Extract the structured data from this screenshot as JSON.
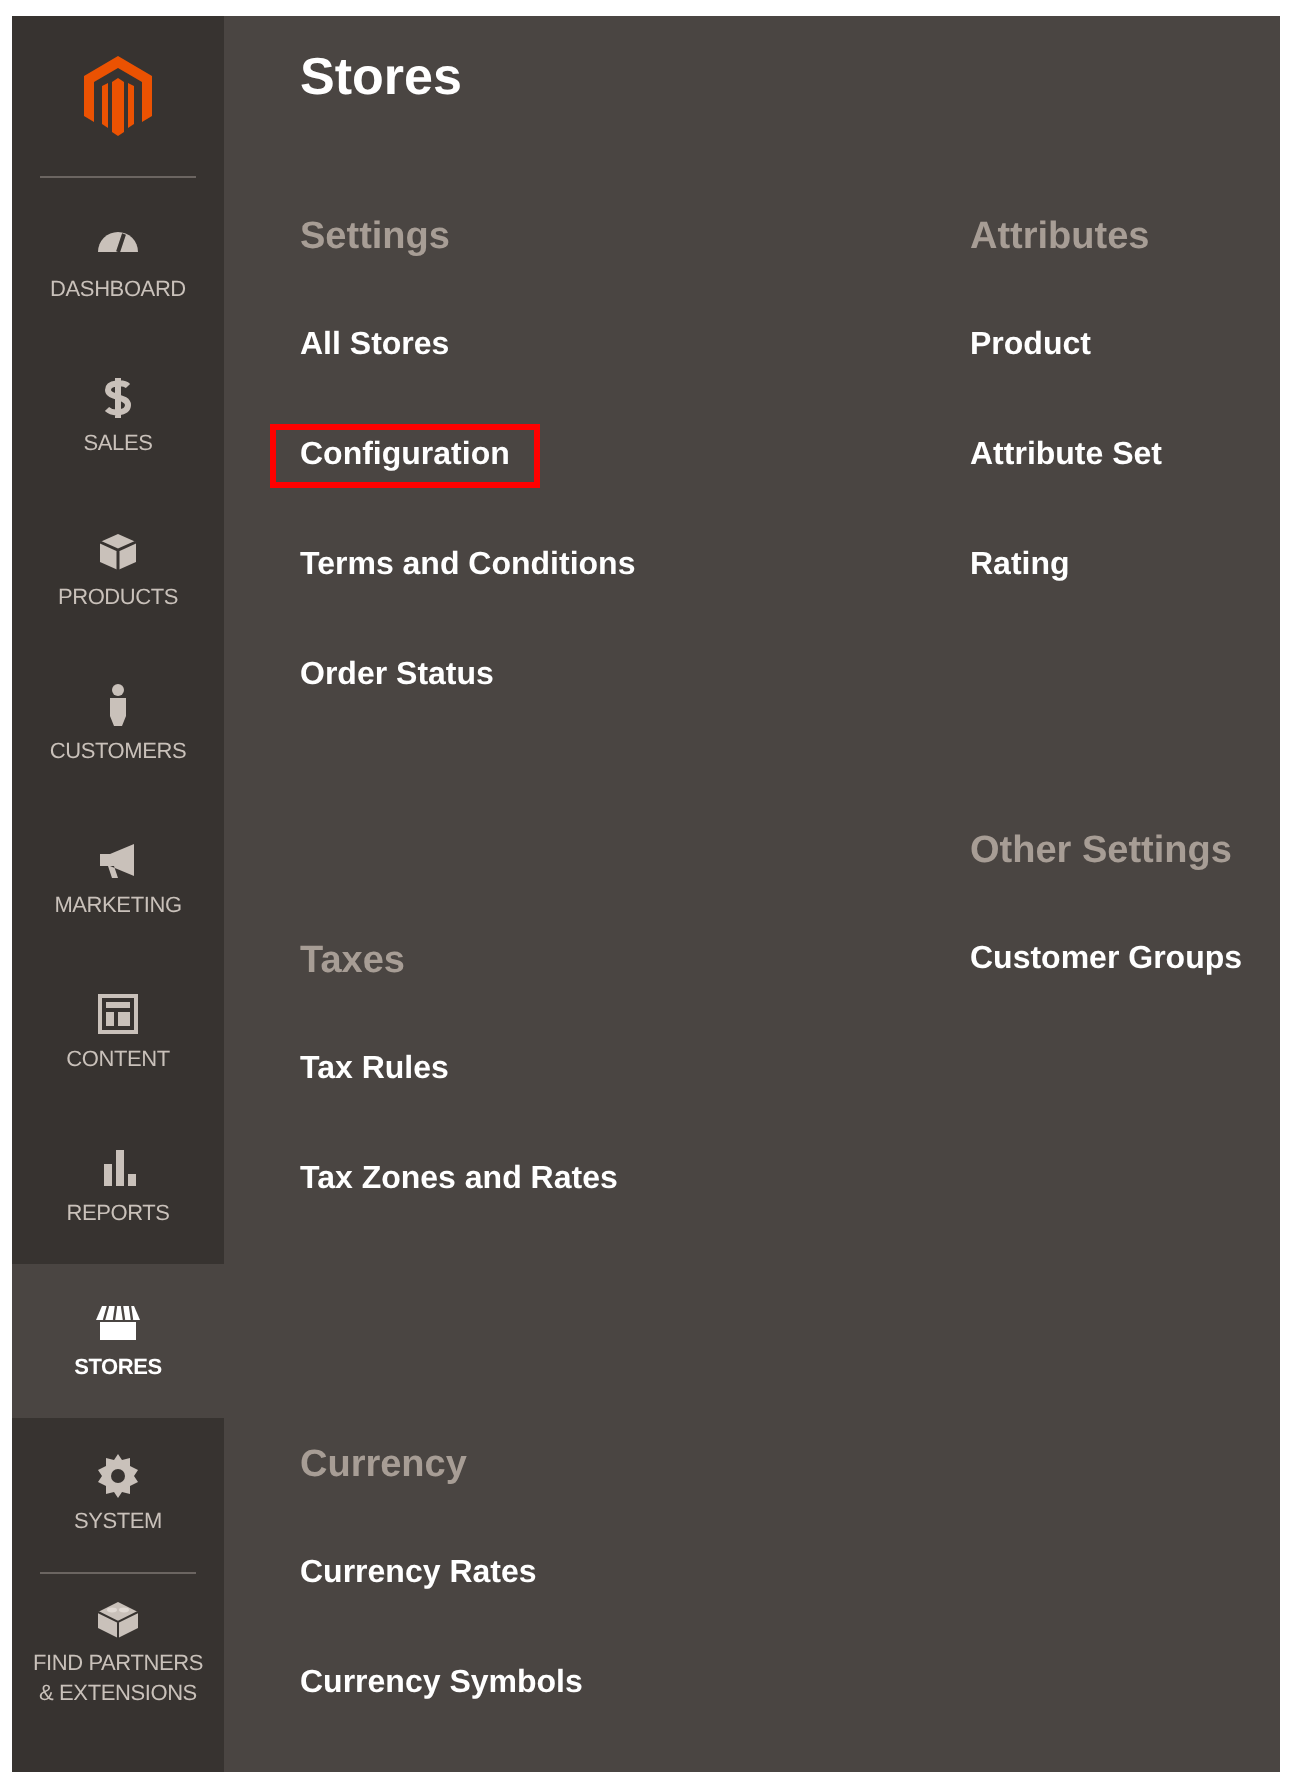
{
  "sidebar": {
    "items": [
      {
        "label": "DASHBOARD",
        "selected": false
      },
      {
        "label": "SALES",
        "selected": false
      },
      {
        "label": "PRODUCTS",
        "selected": false
      },
      {
        "label": "CUSTOMERS",
        "selected": false
      },
      {
        "label": "MARKETING",
        "selected": false
      },
      {
        "label": "CONTENT",
        "selected": false
      },
      {
        "label": "REPORTS",
        "selected": false
      },
      {
        "label": "STORES",
        "selected": true
      },
      {
        "label": "SYSTEM",
        "selected": false
      },
      {
        "label": "FIND PARTNERS & EXTENSIONS",
        "selected": false
      }
    ]
  },
  "page": {
    "title": "Stores",
    "columns": [
      [
        {
          "heading": "Settings",
          "links": [
            {
              "label": "All Stores",
              "highlighted": false
            },
            {
              "label": "Configuration",
              "highlighted": true
            },
            {
              "label": "Terms and Conditions",
              "highlighted": false
            },
            {
              "label": "Order Status",
              "highlighted": false
            }
          ]
        },
        {
          "heading": "Taxes",
          "links": [
            {
              "label": "Tax Rules",
              "highlighted": false
            },
            {
              "label": "Tax Zones and Rates",
              "highlighted": false
            }
          ]
        },
        {
          "heading": "Currency",
          "links": [
            {
              "label": "Currency Rates",
              "highlighted": false
            },
            {
              "label": "Currency Symbols",
              "highlighted": false
            }
          ]
        }
      ],
      [
        {
          "heading": "Attributes",
          "links": [
            {
              "label": "Product",
              "highlighted": false
            },
            {
              "label": "Attribute Set",
              "highlighted": false
            },
            {
              "label": "Rating",
              "highlighted": false
            }
          ]
        },
        {
          "heading": "Other Settings",
          "links": [
            {
              "label": "Customer Groups",
              "highlighted": false
            }
          ]
        }
      ]
    ]
  }
}
